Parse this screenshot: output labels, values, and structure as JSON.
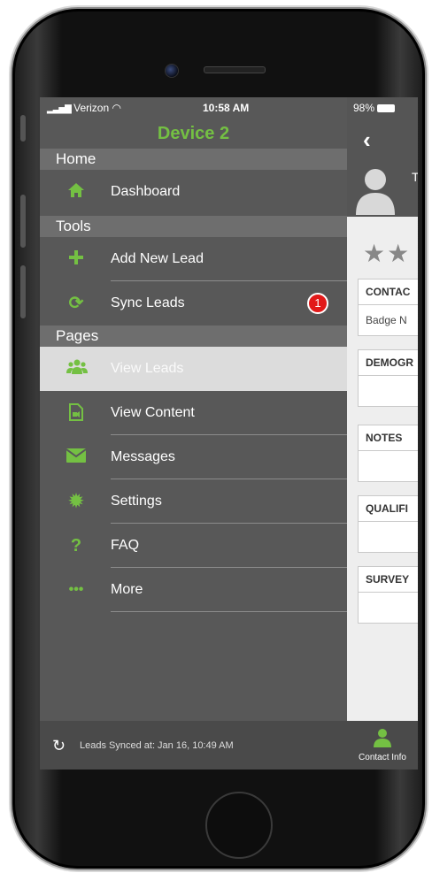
{
  "status_bar": {
    "carrier": "Verizon",
    "time": "10:58 AM",
    "battery": "98%"
  },
  "drawer": {
    "title": "Device 2",
    "sections": [
      {
        "label": "Home",
        "items": [
          {
            "label": "Dashboard",
            "icon": "home-icon"
          }
        ]
      },
      {
        "label": "Tools",
        "items": [
          {
            "label": "Add New Lead",
            "icon": "plus-icon"
          },
          {
            "label": "Sync Leads",
            "icon": "sync-icon",
            "badge": "1"
          }
        ]
      },
      {
        "label": "Pages",
        "items": [
          {
            "label": "View Leads",
            "icon": "users-icon",
            "active": true
          },
          {
            "label": "View Content",
            "icon": "media-file-icon"
          },
          {
            "label": "Messages",
            "icon": "envelope-icon"
          },
          {
            "label": "Settings",
            "icon": "gear-icon"
          },
          {
            "label": "FAQ",
            "icon": "question-icon"
          },
          {
            "label": "More",
            "icon": "ellipsis-icon"
          }
        ]
      }
    ],
    "footer": {
      "text": "Leads Synced at: Jan 16, 10:49 AM",
      "icon": "refresh-icon"
    }
  },
  "main": {
    "back_icon": "chevron-left-icon",
    "name_initial": "T",
    "cards": [
      {
        "title": "CONTAC",
        "body": "Badge N"
      },
      {
        "title": "DEMOGR",
        "body": ""
      },
      {
        "title": "NOTES",
        "body": ""
      },
      {
        "title": "QUALIFI",
        "body": ""
      },
      {
        "title": "SURVEY",
        "body": ""
      }
    ],
    "tab": {
      "label": "Contact Info",
      "icon": "person-icon"
    }
  },
  "colors": {
    "accent": "#74c043",
    "badge": "#e21a1a",
    "drawer_bg": "#585858"
  }
}
